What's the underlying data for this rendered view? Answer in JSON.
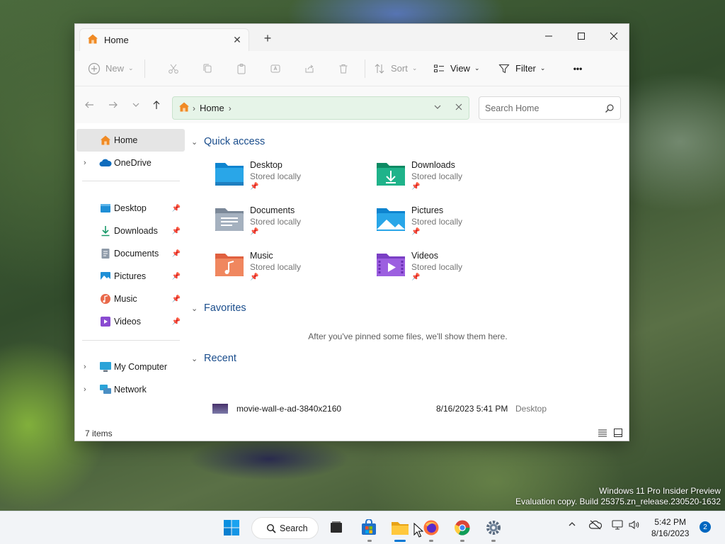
{
  "window": {
    "tab_title": "Home",
    "new_tab_label": "+"
  },
  "toolbar": {
    "new_label": "New",
    "sort_label": "Sort",
    "view_label": "View",
    "filter_label": "Filter",
    "more_label": "•••"
  },
  "address": {
    "crumb": "Home",
    "separator": "›"
  },
  "search": {
    "placeholder": "Search Home"
  },
  "sidebar": {
    "items": [
      {
        "label": "Home"
      },
      {
        "label": "OneDrive"
      },
      {
        "label": "Desktop"
      },
      {
        "label": "Downloads"
      },
      {
        "label": "Documents"
      },
      {
        "label": "Pictures"
      },
      {
        "label": "Music"
      },
      {
        "label": "Videos"
      },
      {
        "label": "My Computer"
      },
      {
        "label": "Network"
      }
    ]
  },
  "main": {
    "quick_access_title": "Quick access",
    "favorites_title": "Favorites",
    "recent_title": "Recent",
    "favorites_empty": "After you've pinned some files, we'll show them here.",
    "quick_access": [
      {
        "name": "Desktop",
        "sub": "Stored locally"
      },
      {
        "name": "Downloads",
        "sub": "Stored locally"
      },
      {
        "name": "Documents",
        "sub": "Stored locally"
      },
      {
        "name": "Pictures",
        "sub": "Stored locally"
      },
      {
        "name": "Music",
        "sub": "Stored locally"
      },
      {
        "name": "Videos",
        "sub": "Stored locally"
      }
    ],
    "recent": [
      {
        "name": "movie-wall-e-ad-3840x2160",
        "date": "8/16/2023 5:41 PM",
        "location": "Desktop"
      }
    ]
  },
  "status": {
    "item_count": "7 items"
  },
  "taskbar": {
    "search_label": "Search",
    "time": "5:42 PM",
    "date": "8/16/2023",
    "notifications": "2"
  },
  "watermark": {
    "line1": "Windows 11 Pro Insider Preview",
    "line2": "Evaluation copy. Build 25375.zn_release.230520-1632"
  },
  "colors": {
    "accent": "#0078d4",
    "address_bg": "#e6f4e8",
    "section_title": "#1a4d8c"
  }
}
